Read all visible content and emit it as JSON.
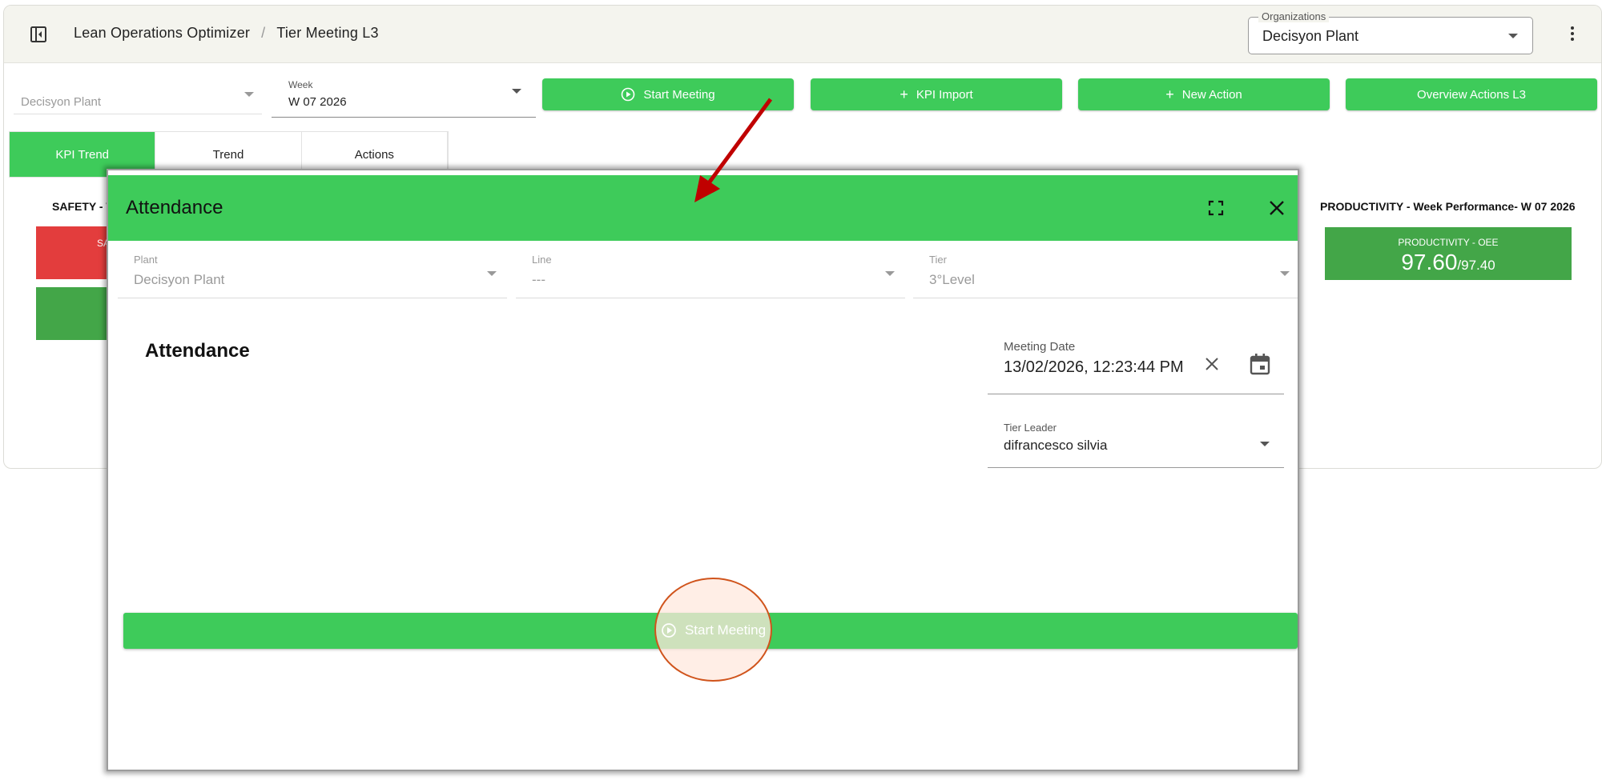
{
  "header": {
    "breadcrumb": [
      "Lean Operations Optimizer",
      "Tier Meeting L3"
    ],
    "breadcrumb_sep": "/",
    "organizations_label": "Organizations",
    "organizations_value": "Decisyon Plant"
  },
  "filters": {
    "plant_value": "Decisyon Plant",
    "week_label": "Week",
    "week_value": "W 07 2026"
  },
  "toolbar": {
    "start_meeting": "Start Meeting",
    "kpi_import": "KPI Import",
    "new_action": "New Action",
    "overview_actions": "Overview Actions L3"
  },
  "tabs": [
    "KPI Trend",
    "Trend",
    "Actions"
  ],
  "dashboard": {
    "safety_title": "SAFETY - W",
    "safety_tile_text": "SA",
    "productivity_title": "PRODUCTIVITY - Week Performance- W 07 2026",
    "productivity_tile_label": "PRODUCTIVITY - OEE",
    "productivity_value": "97.60",
    "productivity_target": "/97.40"
  },
  "modal": {
    "title": "Attendance",
    "plant_label": "Plant",
    "plant_value": "Decisyon Plant",
    "line_label": "Line",
    "line_value": "---",
    "tier_label": "Tier",
    "tier_value": "3°Level",
    "section_title": "Attendance",
    "meeting_date_label": "Meeting Date",
    "meeting_date_value": "13/02/2026, 12:23:44 PM",
    "tier_leader_label": "Tier Leader",
    "tier_leader_value": "difrancesco silvia",
    "start_button": "Start Meeting"
  },
  "colors": {
    "accent_green": "#3ecb5a",
    "tile_green": "#43a648",
    "tile_red": "#e33d3d",
    "annotation_arrow": "#c00000",
    "highlight_stroke": "#d0541c"
  },
  "icons": [
    "sidebar-toggle-icon",
    "more-vert-icon",
    "play-circle-icon",
    "plus-icon",
    "fullscreen-icon",
    "close-icon",
    "clear-icon",
    "calendar-icon",
    "chevron-down-icon"
  ]
}
